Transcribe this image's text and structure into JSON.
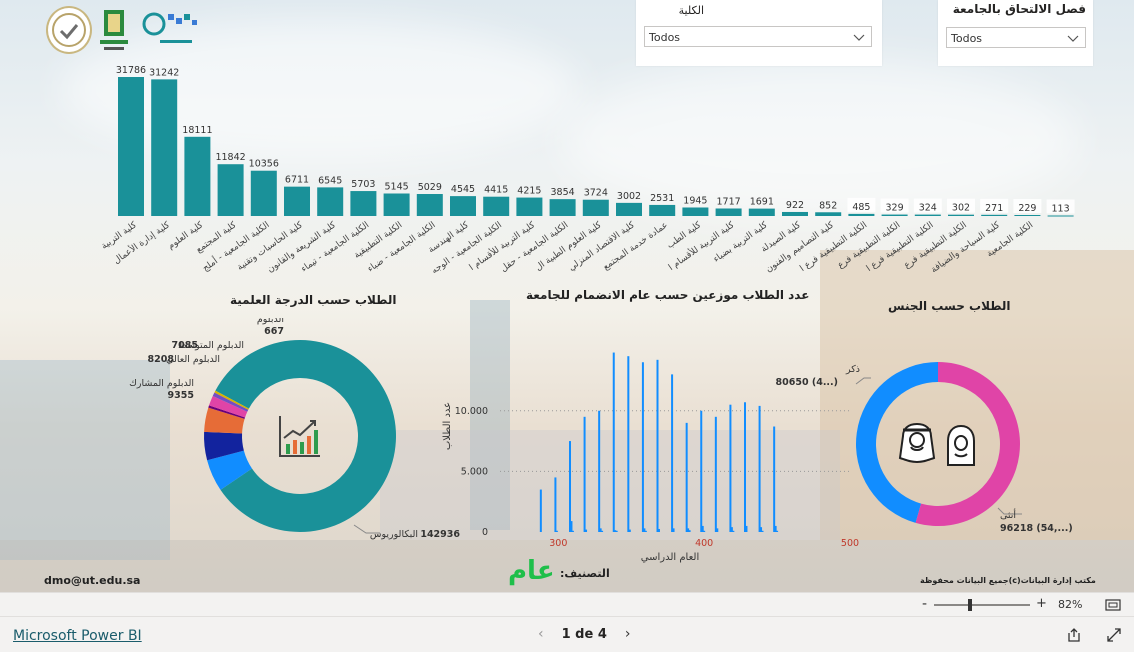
{
  "filters": {
    "college": {
      "title": "الكلية",
      "value": "Todos"
    },
    "semester": {
      "title": "فصل الالتحاق بالجامعة",
      "value": "Todos"
    }
  },
  "chart_data": [
    {
      "type": "bar",
      "title": "",
      "color": "#1a9199",
      "categories": [
        "كلية التربية",
        "كلية إدارة الأعمال",
        "كلية العلوم",
        "كلية المجتمع",
        "الكلية الجامعية - أملج",
        "كلية الحاسبات وتقنية",
        "كلية الشريعة والقانون",
        "الكلية الجامعية - تيماء",
        "الكلية التطبيقية",
        "الكلية الجامعية - ضباء",
        "كلية الهندسة",
        "الكلية الجامعية - الوجه",
        "كلية التربية للأقسام ا",
        "الكلية الجامعية - حقل",
        "كلية العلوم الطبية ال",
        "كلية الاقتصاد المنزلي",
        "عمادة خدمة المجتمع",
        "كلية الطب",
        "كلية التربية للأقسام ا",
        "كلية التربية بضباء",
        "كلية الصيدلة",
        "كلية التصاميم والفنون",
        "الكلية التطبيقية فرع ا",
        "الكلية التطبيقية فرع",
        "الكلية التطبيقية فرع ا",
        "الكلية التطبيقية فرع",
        "كلية السياحة والضيافة",
        "الكلية الجامعية"
      ],
      "values": [
        31786,
        31242,
        18111,
        11842,
        10356,
        6711,
        6545,
        5703,
        5145,
        5029,
        4545,
        4415,
        4215,
        3854,
        3724,
        3002,
        2531,
        1945,
        1717,
        1691,
        922,
        852,
        485,
        329,
        324,
        302,
        271,
        229,
        113
      ]
    },
    {
      "type": "pie",
      "title": "الطلاب حسب الدرجة العلمية",
      "slices": [
        {
          "label": "البكالوريوس",
          "value": 142936,
          "color": "#1a9199"
        },
        {
          "label": "الدبلوم المشارك",
          "value": 9355,
          "color": "#118dff"
        },
        {
          "label": "الدبلوم العالي",
          "value": 8208,
          "color": "#12239e"
        },
        {
          "label": "الدبلوم المتوسط",
          "value": 7085,
          "color": "#e66c37"
        },
        {
          "label": "الدبلوم",
          "value": 667,
          "color": "#6b007b"
        },
        {
          "label": "",
          "value": 2900,
          "color": "#e044a7"
        },
        {
          "label": "",
          "value": 1100,
          "color": "#744ec2"
        },
        {
          "label": "",
          "value": 600,
          "color": "#d9b300"
        }
      ]
    },
    {
      "type": "bar",
      "title": "عدد الطلاب موزعين حسب عام الانضمام للجامعة",
      "xlabel": "العام الدراسي",
      "ylabel": "عدد الطلاب",
      "color": "#118dff",
      "xlim": [
        260,
        500
      ],
      "ylim": [
        0,
        16000
      ],
      "xticks": [
        300,
        400,
        500
      ],
      "yticks": [
        {
          "value": 0,
          "label": "0"
        },
        {
          "value": 5000,
          "label": "5.000"
        },
        {
          "value": 10000,
          "label": "10.000"
        }
      ],
      "x": [
        288,
        298,
        299,
        308,
        309,
        310,
        318,
        319,
        328,
        329,
        330,
        338,
        339,
        340,
        348,
        349,
        358,
        359,
        360,
        368,
        369,
        378,
        379,
        388,
        389,
        390,
        398,
        399,
        400,
        408,
        409,
        418,
        419,
        420,
        428,
        429,
        438,
        439,
        440,
        448,
        449,
        450
      ],
      "y": [
        3500,
        4500,
        100,
        7500,
        900,
        100,
        9500,
        200,
        10000,
        300,
        100,
        14800,
        150,
        100,
        14500,
        200,
        14000,
        300,
        100,
        14200,
        250,
        13000,
        300,
        9000,
        300,
        150,
        10000,
        500,
        100,
        9500,
        300,
        10500,
        400,
        100,
        10700,
        500,
        10400,
        400,
        100,
        8700,
        500,
        100
      ]
    },
    {
      "type": "pie",
      "title": "الطلاب حسب الجنس",
      "slices": [
        {
          "label": "ذكر",
          "value": 80650,
          "display": "80650 (4...)",
          "color": "#118dff"
        },
        {
          "label": "أنثى",
          "value": 96218,
          "display": "96218 (54,...)",
          "color": "#e044a7"
        }
      ]
    }
  ],
  "footer": {
    "email": "dmo@ut.edu.sa",
    "classification_label": "التصنيف:",
    "classification_value": "عام",
    "rights": "مكتب إدارة البيانات(c)جميع البيانات محفوظة"
  },
  "zoom": {
    "minus": "-",
    "plus": "+",
    "value": "82%",
    "level": 0.5
  },
  "bottom": {
    "product_link": "Microsoft Power BI",
    "page_indicator": "1 de 4",
    "prev": "‹",
    "next": "›"
  },
  "icons": [
    "accreditation-logo",
    "university-of-tabuk-logo",
    "data-management-logo",
    "growth-chart-icon",
    "male-student-icon",
    "female-student-icon",
    "fit-to-page-icon",
    "share-icon",
    "fullscreen-icon"
  ]
}
